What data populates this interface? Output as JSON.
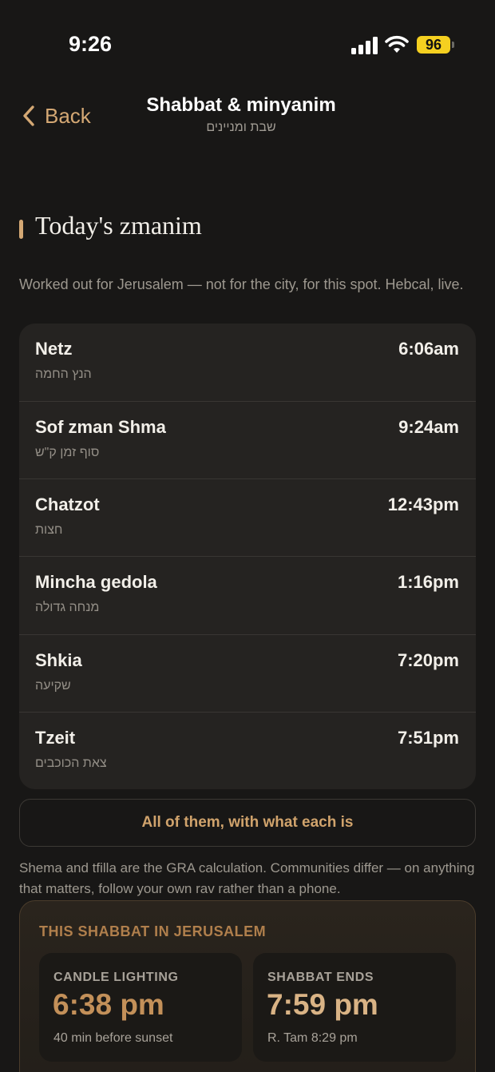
{
  "status": {
    "time": "9:26",
    "battery": "96"
  },
  "nav": {
    "back_label": "Back",
    "title": "Shabbat & minyanim",
    "subtitle": "שבת ומניינים"
  },
  "zmanim": {
    "heading": "Today's zmanim",
    "intro": "Worked out for Jerusalem — not for the city, for this spot. Hebcal, live.",
    "rows": [
      {
        "name": "Netz",
        "hebrew": "הנץ החמה",
        "time": "6:06am"
      },
      {
        "name": "Sof zman Shma",
        "hebrew": "סוף זמן ק\"ש",
        "time": "9:24am"
      },
      {
        "name": "Chatzot",
        "hebrew": "חצות",
        "time": "12:43pm"
      },
      {
        "name": "Mincha gedola",
        "hebrew": "מנחה גדולה",
        "time": "1:16pm"
      },
      {
        "name": "Shkia",
        "hebrew": "שקיעה",
        "time": "7:20pm"
      },
      {
        "name": "Tzeit",
        "hebrew": "צאת הכוכבים",
        "time": "7:51pm"
      }
    ],
    "all_button": "All of them, with what each is",
    "note": "Shema and tfilla are the GRA calculation. Communities differ — on anything that matters, follow your own rav rather than a phone."
  },
  "shabbat": {
    "heading": "THIS SHABBAT IN JERUSALEM",
    "candle": {
      "label": "CANDLE LIGHTING",
      "value": "6:38 pm",
      "sub": "40 min before sunset"
    },
    "ends": {
      "label": "SHABBAT ENDS",
      "value": "7:59 pm",
      "sub": "R. Tam 8:29 pm"
    }
  }
}
